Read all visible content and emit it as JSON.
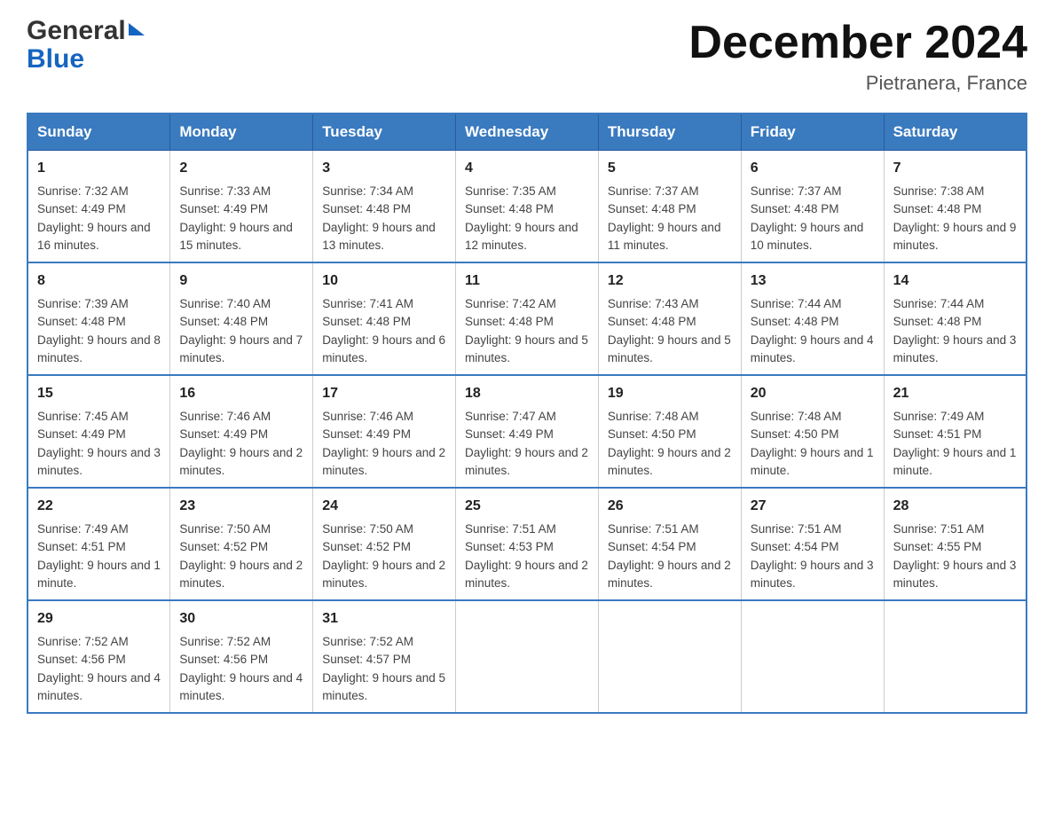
{
  "header": {
    "logo_general": "General",
    "logo_blue": "Blue",
    "month_title": "December 2024",
    "location": "Pietranera, France"
  },
  "days_of_week": [
    "Sunday",
    "Monday",
    "Tuesday",
    "Wednesday",
    "Thursday",
    "Friday",
    "Saturday"
  ],
  "weeks": [
    [
      {
        "day": "1",
        "sunrise": "7:32 AM",
        "sunset": "4:49 PM",
        "daylight": "9 hours and 16 minutes."
      },
      {
        "day": "2",
        "sunrise": "7:33 AM",
        "sunset": "4:49 PM",
        "daylight": "9 hours and 15 minutes."
      },
      {
        "day": "3",
        "sunrise": "7:34 AM",
        "sunset": "4:48 PM",
        "daylight": "9 hours and 13 minutes."
      },
      {
        "day": "4",
        "sunrise": "7:35 AM",
        "sunset": "4:48 PM",
        "daylight": "9 hours and 12 minutes."
      },
      {
        "day": "5",
        "sunrise": "7:37 AM",
        "sunset": "4:48 PM",
        "daylight": "9 hours and 11 minutes."
      },
      {
        "day": "6",
        "sunrise": "7:37 AM",
        "sunset": "4:48 PM",
        "daylight": "9 hours and 10 minutes."
      },
      {
        "day": "7",
        "sunrise": "7:38 AM",
        "sunset": "4:48 PM",
        "daylight": "9 hours and 9 minutes."
      }
    ],
    [
      {
        "day": "8",
        "sunrise": "7:39 AM",
        "sunset": "4:48 PM",
        "daylight": "9 hours and 8 minutes."
      },
      {
        "day": "9",
        "sunrise": "7:40 AM",
        "sunset": "4:48 PM",
        "daylight": "9 hours and 7 minutes."
      },
      {
        "day": "10",
        "sunrise": "7:41 AM",
        "sunset": "4:48 PM",
        "daylight": "9 hours and 6 minutes."
      },
      {
        "day": "11",
        "sunrise": "7:42 AM",
        "sunset": "4:48 PM",
        "daylight": "9 hours and 5 minutes."
      },
      {
        "day": "12",
        "sunrise": "7:43 AM",
        "sunset": "4:48 PM",
        "daylight": "9 hours and 5 minutes."
      },
      {
        "day": "13",
        "sunrise": "7:44 AM",
        "sunset": "4:48 PM",
        "daylight": "9 hours and 4 minutes."
      },
      {
        "day": "14",
        "sunrise": "7:44 AM",
        "sunset": "4:48 PM",
        "daylight": "9 hours and 3 minutes."
      }
    ],
    [
      {
        "day": "15",
        "sunrise": "7:45 AM",
        "sunset": "4:49 PM",
        "daylight": "9 hours and 3 minutes."
      },
      {
        "day": "16",
        "sunrise": "7:46 AM",
        "sunset": "4:49 PM",
        "daylight": "9 hours and 2 minutes."
      },
      {
        "day": "17",
        "sunrise": "7:46 AM",
        "sunset": "4:49 PM",
        "daylight": "9 hours and 2 minutes."
      },
      {
        "day": "18",
        "sunrise": "7:47 AM",
        "sunset": "4:49 PM",
        "daylight": "9 hours and 2 minutes."
      },
      {
        "day": "19",
        "sunrise": "7:48 AM",
        "sunset": "4:50 PM",
        "daylight": "9 hours and 2 minutes."
      },
      {
        "day": "20",
        "sunrise": "7:48 AM",
        "sunset": "4:50 PM",
        "daylight": "9 hours and 1 minute."
      },
      {
        "day": "21",
        "sunrise": "7:49 AM",
        "sunset": "4:51 PM",
        "daylight": "9 hours and 1 minute."
      }
    ],
    [
      {
        "day": "22",
        "sunrise": "7:49 AM",
        "sunset": "4:51 PM",
        "daylight": "9 hours and 1 minute."
      },
      {
        "day": "23",
        "sunrise": "7:50 AM",
        "sunset": "4:52 PM",
        "daylight": "9 hours and 2 minutes."
      },
      {
        "day": "24",
        "sunrise": "7:50 AM",
        "sunset": "4:52 PM",
        "daylight": "9 hours and 2 minutes."
      },
      {
        "day": "25",
        "sunrise": "7:51 AM",
        "sunset": "4:53 PM",
        "daylight": "9 hours and 2 minutes."
      },
      {
        "day": "26",
        "sunrise": "7:51 AM",
        "sunset": "4:54 PM",
        "daylight": "9 hours and 2 minutes."
      },
      {
        "day": "27",
        "sunrise": "7:51 AM",
        "sunset": "4:54 PM",
        "daylight": "9 hours and 3 minutes."
      },
      {
        "day": "28",
        "sunrise": "7:51 AM",
        "sunset": "4:55 PM",
        "daylight": "9 hours and 3 minutes."
      }
    ],
    [
      {
        "day": "29",
        "sunrise": "7:52 AM",
        "sunset": "4:56 PM",
        "daylight": "9 hours and 4 minutes."
      },
      {
        "day": "30",
        "sunrise": "7:52 AM",
        "sunset": "4:56 PM",
        "daylight": "9 hours and 4 minutes."
      },
      {
        "day": "31",
        "sunrise": "7:52 AM",
        "sunset": "4:57 PM",
        "daylight": "9 hours and 5 minutes."
      },
      null,
      null,
      null,
      null
    ]
  ],
  "labels": {
    "sunrise": "Sunrise:",
    "sunset": "Sunset:",
    "daylight": "Daylight:"
  }
}
